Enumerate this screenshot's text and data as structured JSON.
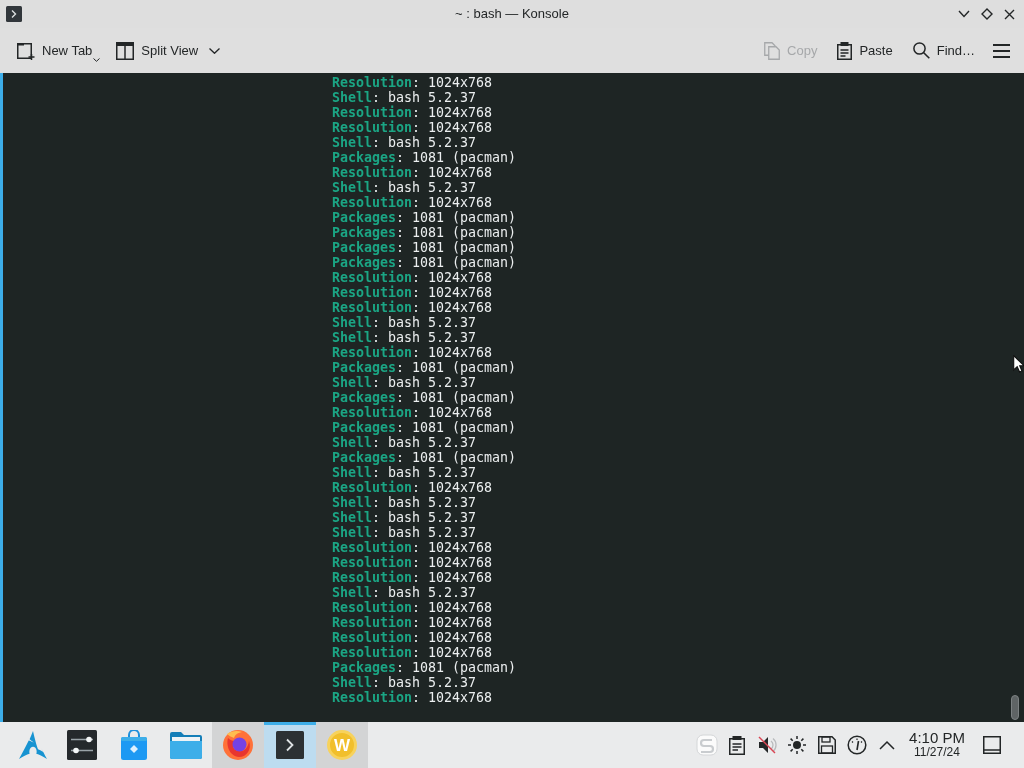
{
  "window": {
    "title": "~ : bash — Konsole"
  },
  "toolbar": {
    "left": [
      {
        "label": "New Tab",
        "disabled": false
      },
      {
        "label": "Split View",
        "disabled": false
      }
    ],
    "right": [
      {
        "label": "Copy",
        "disabled": true
      },
      {
        "label": "Paste",
        "disabled": false
      },
      {
        "label": "Find…",
        "disabled": false
      }
    ]
  },
  "terminal": {
    "lines": [
      "**Resolution**: 1024x768",
      "**Shell**: bash 5.2.37",
      "**Resolution**: 1024x768",
      "**Resolution**: 1024x768",
      "**Shell**: bash 5.2.37",
      "**Packages**: 1081 (pacman)",
      "**Resolution**: 1024x768",
      "**Shell**: bash 5.2.37",
      "**Resolution**: 1024x768",
      "**Packages**: 1081 (pacman)",
      "**Packages**: 1081 (pacman)",
      "**Packages**: 1081 (pacman)",
      "**Packages**: 1081 (pacman)",
      "**Resolution**: 1024x768",
      "**Resolution**: 1024x768",
      "**Resolution**: 1024x768",
      "**Shell**: bash 5.2.37",
      "**Shell**: bash 5.2.37",
      "**Resolution**: 1024x768",
      "**Packages**: 1081 (pacman)",
      "**Shell**: bash 5.2.37",
      "**Packages**: 1081 (pacman)",
      "**Resolution**: 1024x768",
      "**Packages**: 1081 (pacman)",
      "**Shell**: bash 5.2.37",
      "**Packages**: 1081 (pacman)",
      "**Shell**: bash 5.2.37",
      "**Resolution**: 1024x768",
      "**Shell**: bash 5.2.37",
      "**Shell**: bash 5.2.37",
      "**Shell**: bash 5.2.37",
      "**Resolution**: 1024x768",
      "**Resolution**: 1024x768",
      "**Resolution**: 1024x768",
      "**Shell**: bash 5.2.37",
      "**Resolution**: 1024x768",
      "**Resolution**: 1024x768",
      "**Resolution**: 1024x768",
      "**Resolution**: 1024x768",
      "**Packages**: 1081 (pacman)",
      "**Shell**: bash 5.2.37",
      "**Resolution**: 1024x768"
    ]
  },
  "taskbar": {
    "tasks": [
      {
        "open": false,
        "selected": false
      },
      {
        "open": false,
        "selected": false
      },
      {
        "open": false,
        "selected": false
      },
      {
        "open": true,
        "selected": false
      },
      {
        "open": true,
        "selected": true
      },
      {
        "open": true,
        "selected": false,
        "logo_text": "W"
      }
    ],
    "clock": {
      "time": "4:10 PM",
      "date": "11/27/24"
    }
  }
}
